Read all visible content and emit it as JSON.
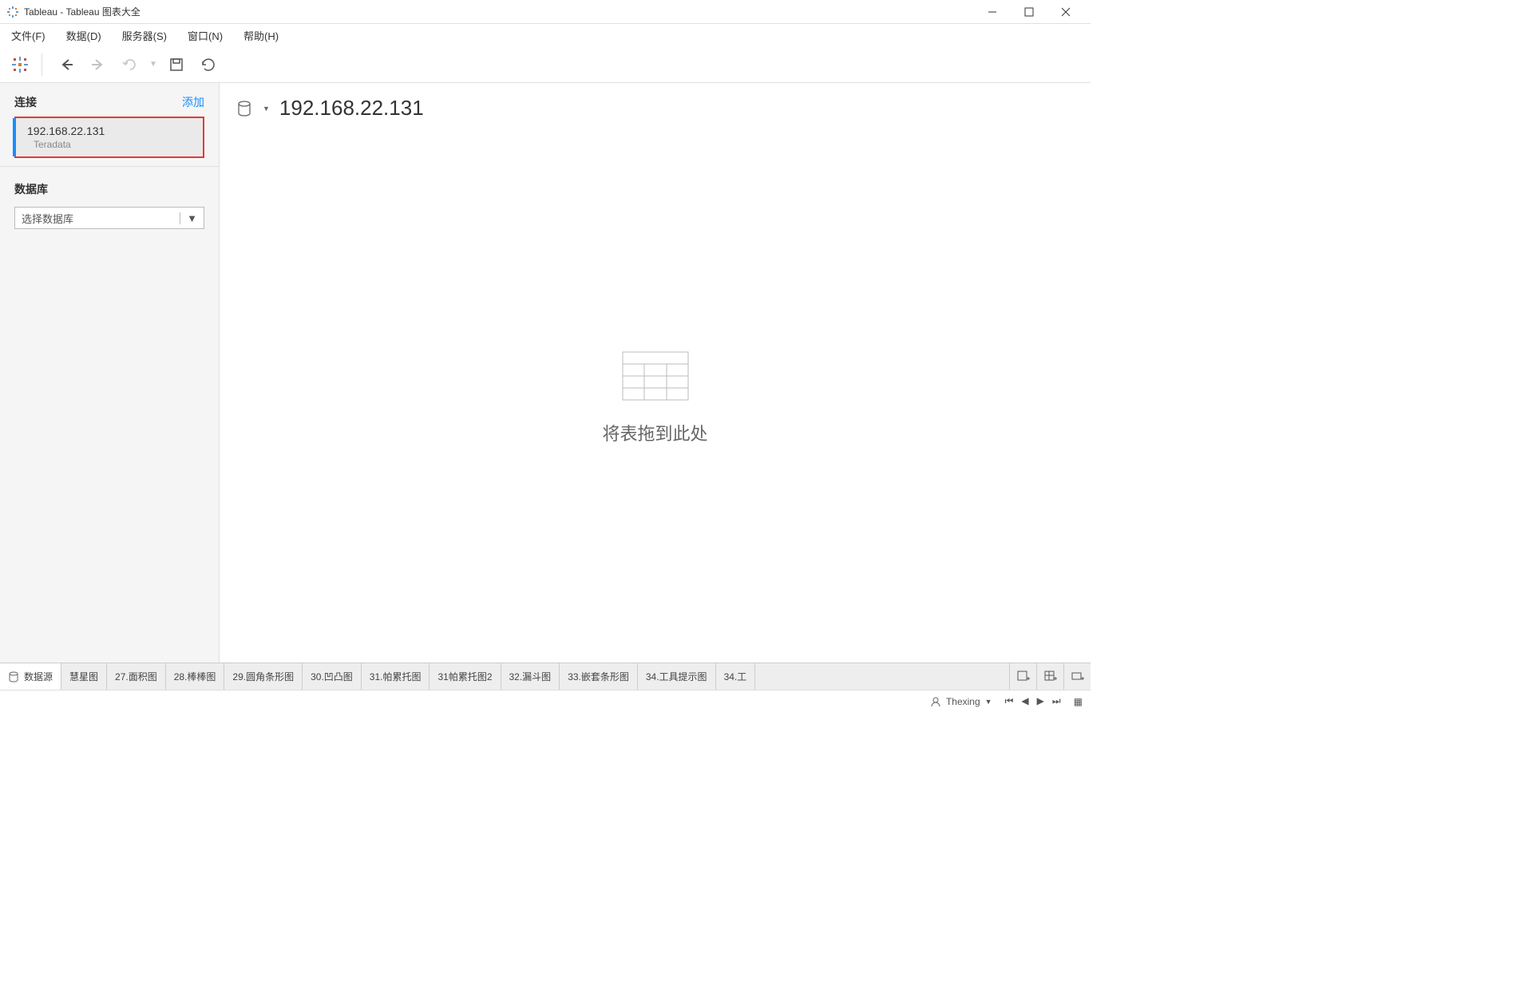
{
  "window": {
    "title": "Tableau - Tableau 图表大全"
  },
  "menu": {
    "file": "文件(F)",
    "data": "数据(D)",
    "server": "服务器(S)",
    "window": "窗口(N)",
    "help": "帮助(H)"
  },
  "sidebar": {
    "connections_label": "连接",
    "add_label": "添加",
    "connection": {
      "name": "192.168.22.131",
      "type": "Teradata"
    },
    "database_label": "数据库",
    "database_select": "选择数据库"
  },
  "canvas": {
    "title": "192.168.22.131",
    "drop_hint": "将表拖到此处"
  },
  "tabs": {
    "datasource": "数据源",
    "items": [
      "慧星图",
      "27.面积图",
      "28.棒棒图",
      "29.圆角条形图",
      "30.凹凸图",
      "31.帕累托图",
      "31帕累托图2",
      "32.漏斗图",
      "33.嵌套条形图",
      "34.工具提示图",
      "34.工"
    ]
  },
  "status": {
    "user": "Thexing"
  }
}
